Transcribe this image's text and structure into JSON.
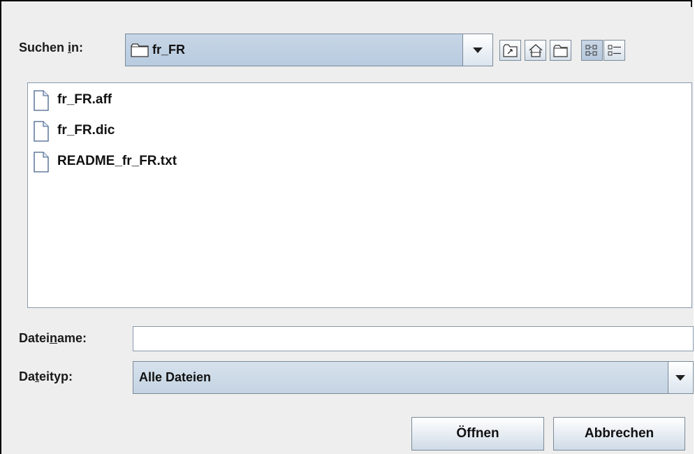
{
  "dialog": {
    "look_in": {
      "label_pre": "Suchen ",
      "label_mnemonic": "i",
      "label_post": "n:",
      "value": "fr_FR"
    },
    "toolbar": [
      {
        "name": "up-one-level-button",
        "icon": "folder-up-icon"
      },
      {
        "name": "home-button",
        "icon": "home-icon"
      },
      {
        "name": "new-folder-button",
        "icon": "new-folder-icon"
      },
      {
        "name": "list-view-button",
        "icon": "list-view-icon",
        "pressed": true
      },
      {
        "name": "details-view-button",
        "icon": "details-view-icon"
      }
    ],
    "files": [
      "fr_FR.aff",
      "fr_FR.dic",
      "README_fr_FR.txt"
    ],
    "filename": {
      "label_pre": "Datei",
      "label_mnemonic": "n",
      "label_post": "ame:",
      "value": ""
    },
    "filetype": {
      "label_pre": "Da",
      "label_mnemonic": "t",
      "label_post": "eityp:",
      "value": "Alle Dateien"
    },
    "buttons": {
      "open": "Öffnen",
      "cancel": "Abbrechen"
    }
  },
  "colors": {
    "combo_bg": "#c0d1e3",
    "border": "#7a8a99",
    "panel_bg": "#eeeeee"
  }
}
